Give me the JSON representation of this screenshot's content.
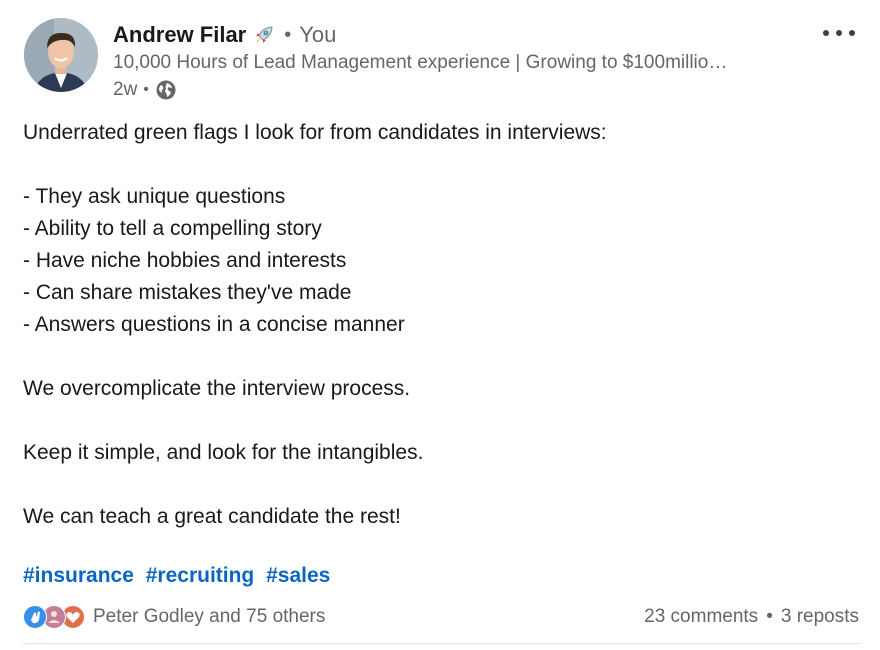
{
  "author": {
    "name": "Andrew Filar",
    "badge_icon": "rocket-icon",
    "relation": "You",
    "headline": "10,000 Hours of Lead Management experience | Growing to $100millio…",
    "time_ago": "2w",
    "visibility_icon": "globe-icon"
  },
  "menu": {
    "icon": "more-options-icon"
  },
  "post": {
    "intro": "Underrated green flags I look for from candidates in interviews:",
    "list": [
      "- They ask unique questions",
      "- Ability to tell a compelling story",
      "- Have niche hobbies and interests",
      "- Can share mistakes they've made",
      "- Answers questions in a concise manner"
    ],
    "paragraphs": [
      "We overcomplicate the interview process.",
      "Keep it simple, and look for the intangibles.",
      "We can teach a great candidate the rest!"
    ],
    "hashtags": [
      "#insurance",
      "#recruiting",
      "#sales"
    ]
  },
  "social": {
    "reaction_icons": [
      "clap-icon",
      "support-icon",
      "love-icon"
    ],
    "reactors": "Peter Godley and 75 others",
    "comments": "23 comments",
    "reposts": "3 reposts"
  },
  "colors": {
    "link": "#0a66c2",
    "muted": "#666666",
    "text": "#191919"
  }
}
